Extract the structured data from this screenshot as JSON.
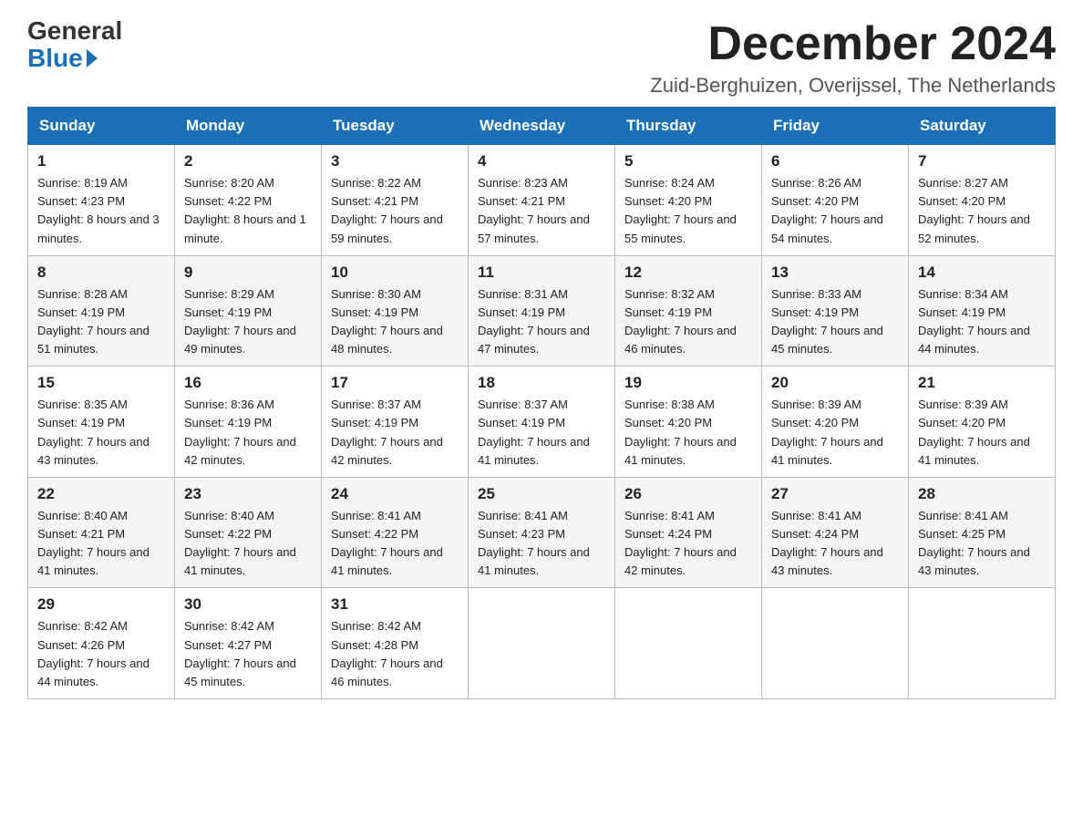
{
  "header": {
    "logo_general": "General",
    "logo_blue": "Blue",
    "month_title": "December 2024",
    "location": "Zuid-Berghuizen, Overijssel, The Netherlands"
  },
  "weekdays": [
    "Sunday",
    "Monday",
    "Tuesday",
    "Wednesday",
    "Thursday",
    "Friday",
    "Saturday"
  ],
  "weeks": [
    [
      {
        "day": "1",
        "sunrise": "Sunrise: 8:19 AM",
        "sunset": "Sunset: 4:23 PM",
        "daylight": "Daylight: 8 hours and 3 minutes."
      },
      {
        "day": "2",
        "sunrise": "Sunrise: 8:20 AM",
        "sunset": "Sunset: 4:22 PM",
        "daylight": "Daylight: 8 hours and 1 minute."
      },
      {
        "day": "3",
        "sunrise": "Sunrise: 8:22 AM",
        "sunset": "Sunset: 4:21 PM",
        "daylight": "Daylight: 7 hours and 59 minutes."
      },
      {
        "day": "4",
        "sunrise": "Sunrise: 8:23 AM",
        "sunset": "Sunset: 4:21 PM",
        "daylight": "Daylight: 7 hours and 57 minutes."
      },
      {
        "day": "5",
        "sunrise": "Sunrise: 8:24 AM",
        "sunset": "Sunset: 4:20 PM",
        "daylight": "Daylight: 7 hours and 55 minutes."
      },
      {
        "day": "6",
        "sunrise": "Sunrise: 8:26 AM",
        "sunset": "Sunset: 4:20 PM",
        "daylight": "Daylight: 7 hours and 54 minutes."
      },
      {
        "day": "7",
        "sunrise": "Sunrise: 8:27 AM",
        "sunset": "Sunset: 4:20 PM",
        "daylight": "Daylight: 7 hours and 52 minutes."
      }
    ],
    [
      {
        "day": "8",
        "sunrise": "Sunrise: 8:28 AM",
        "sunset": "Sunset: 4:19 PM",
        "daylight": "Daylight: 7 hours and 51 minutes."
      },
      {
        "day": "9",
        "sunrise": "Sunrise: 8:29 AM",
        "sunset": "Sunset: 4:19 PM",
        "daylight": "Daylight: 7 hours and 49 minutes."
      },
      {
        "day": "10",
        "sunrise": "Sunrise: 8:30 AM",
        "sunset": "Sunset: 4:19 PM",
        "daylight": "Daylight: 7 hours and 48 minutes."
      },
      {
        "day": "11",
        "sunrise": "Sunrise: 8:31 AM",
        "sunset": "Sunset: 4:19 PM",
        "daylight": "Daylight: 7 hours and 47 minutes."
      },
      {
        "day": "12",
        "sunrise": "Sunrise: 8:32 AM",
        "sunset": "Sunset: 4:19 PM",
        "daylight": "Daylight: 7 hours and 46 minutes."
      },
      {
        "day": "13",
        "sunrise": "Sunrise: 8:33 AM",
        "sunset": "Sunset: 4:19 PM",
        "daylight": "Daylight: 7 hours and 45 minutes."
      },
      {
        "day": "14",
        "sunrise": "Sunrise: 8:34 AM",
        "sunset": "Sunset: 4:19 PM",
        "daylight": "Daylight: 7 hours and 44 minutes."
      }
    ],
    [
      {
        "day": "15",
        "sunrise": "Sunrise: 8:35 AM",
        "sunset": "Sunset: 4:19 PM",
        "daylight": "Daylight: 7 hours and 43 minutes."
      },
      {
        "day": "16",
        "sunrise": "Sunrise: 8:36 AM",
        "sunset": "Sunset: 4:19 PM",
        "daylight": "Daylight: 7 hours and 42 minutes."
      },
      {
        "day": "17",
        "sunrise": "Sunrise: 8:37 AM",
        "sunset": "Sunset: 4:19 PM",
        "daylight": "Daylight: 7 hours and 42 minutes."
      },
      {
        "day": "18",
        "sunrise": "Sunrise: 8:37 AM",
        "sunset": "Sunset: 4:19 PM",
        "daylight": "Daylight: 7 hours and 41 minutes."
      },
      {
        "day": "19",
        "sunrise": "Sunrise: 8:38 AM",
        "sunset": "Sunset: 4:20 PM",
        "daylight": "Daylight: 7 hours and 41 minutes."
      },
      {
        "day": "20",
        "sunrise": "Sunrise: 8:39 AM",
        "sunset": "Sunset: 4:20 PM",
        "daylight": "Daylight: 7 hours and 41 minutes."
      },
      {
        "day": "21",
        "sunrise": "Sunrise: 8:39 AM",
        "sunset": "Sunset: 4:20 PM",
        "daylight": "Daylight: 7 hours and 41 minutes."
      }
    ],
    [
      {
        "day": "22",
        "sunrise": "Sunrise: 8:40 AM",
        "sunset": "Sunset: 4:21 PM",
        "daylight": "Daylight: 7 hours and 41 minutes."
      },
      {
        "day": "23",
        "sunrise": "Sunrise: 8:40 AM",
        "sunset": "Sunset: 4:22 PM",
        "daylight": "Daylight: 7 hours and 41 minutes."
      },
      {
        "day": "24",
        "sunrise": "Sunrise: 8:41 AM",
        "sunset": "Sunset: 4:22 PM",
        "daylight": "Daylight: 7 hours and 41 minutes."
      },
      {
        "day": "25",
        "sunrise": "Sunrise: 8:41 AM",
        "sunset": "Sunset: 4:23 PM",
        "daylight": "Daylight: 7 hours and 41 minutes."
      },
      {
        "day": "26",
        "sunrise": "Sunrise: 8:41 AM",
        "sunset": "Sunset: 4:24 PM",
        "daylight": "Daylight: 7 hours and 42 minutes."
      },
      {
        "day": "27",
        "sunrise": "Sunrise: 8:41 AM",
        "sunset": "Sunset: 4:24 PM",
        "daylight": "Daylight: 7 hours and 43 minutes."
      },
      {
        "day": "28",
        "sunrise": "Sunrise: 8:41 AM",
        "sunset": "Sunset: 4:25 PM",
        "daylight": "Daylight: 7 hours and 43 minutes."
      }
    ],
    [
      {
        "day": "29",
        "sunrise": "Sunrise: 8:42 AM",
        "sunset": "Sunset: 4:26 PM",
        "daylight": "Daylight: 7 hours and 44 minutes."
      },
      {
        "day": "30",
        "sunrise": "Sunrise: 8:42 AM",
        "sunset": "Sunset: 4:27 PM",
        "daylight": "Daylight: 7 hours and 45 minutes."
      },
      {
        "day": "31",
        "sunrise": "Sunrise: 8:42 AM",
        "sunset": "Sunset: 4:28 PM",
        "daylight": "Daylight: 7 hours and 46 minutes."
      },
      null,
      null,
      null,
      null
    ]
  ]
}
